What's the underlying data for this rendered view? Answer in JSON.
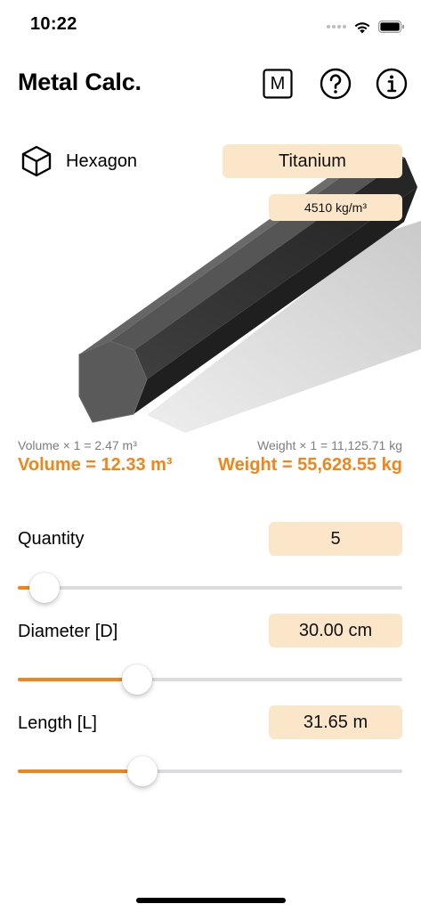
{
  "status_bar": {
    "time": "10:22"
  },
  "header": {
    "title": "Metal Calc.",
    "m_button_label": "M"
  },
  "shape": {
    "icon": "cube-icon",
    "label": "Hexagon"
  },
  "material": {
    "name": "Titanium",
    "density": "4510 kg/m³"
  },
  "results": {
    "volume_single": "Volume × 1 = 2.47 m³",
    "weight_single": "Weight × 1 = 11,125.71 kg",
    "volume_total": "Volume = 12.33 m³",
    "weight_total": "Weight = 55,628.55 kg"
  },
  "controls": [
    {
      "label": "Quantity",
      "value": "5",
      "slider_fraction": 0.07
    },
    {
      "label": "Diameter [D]",
      "value": "30.00 cm",
      "slider_fraction": 0.31
    },
    {
      "label": "Length [L]",
      "value": "31.65 m",
      "slider_fraction": 0.325
    }
  ],
  "colors": {
    "accent": "#f0861a",
    "pill_background": "#fbe6c9",
    "secondary_text": "#7d7d7d"
  }
}
